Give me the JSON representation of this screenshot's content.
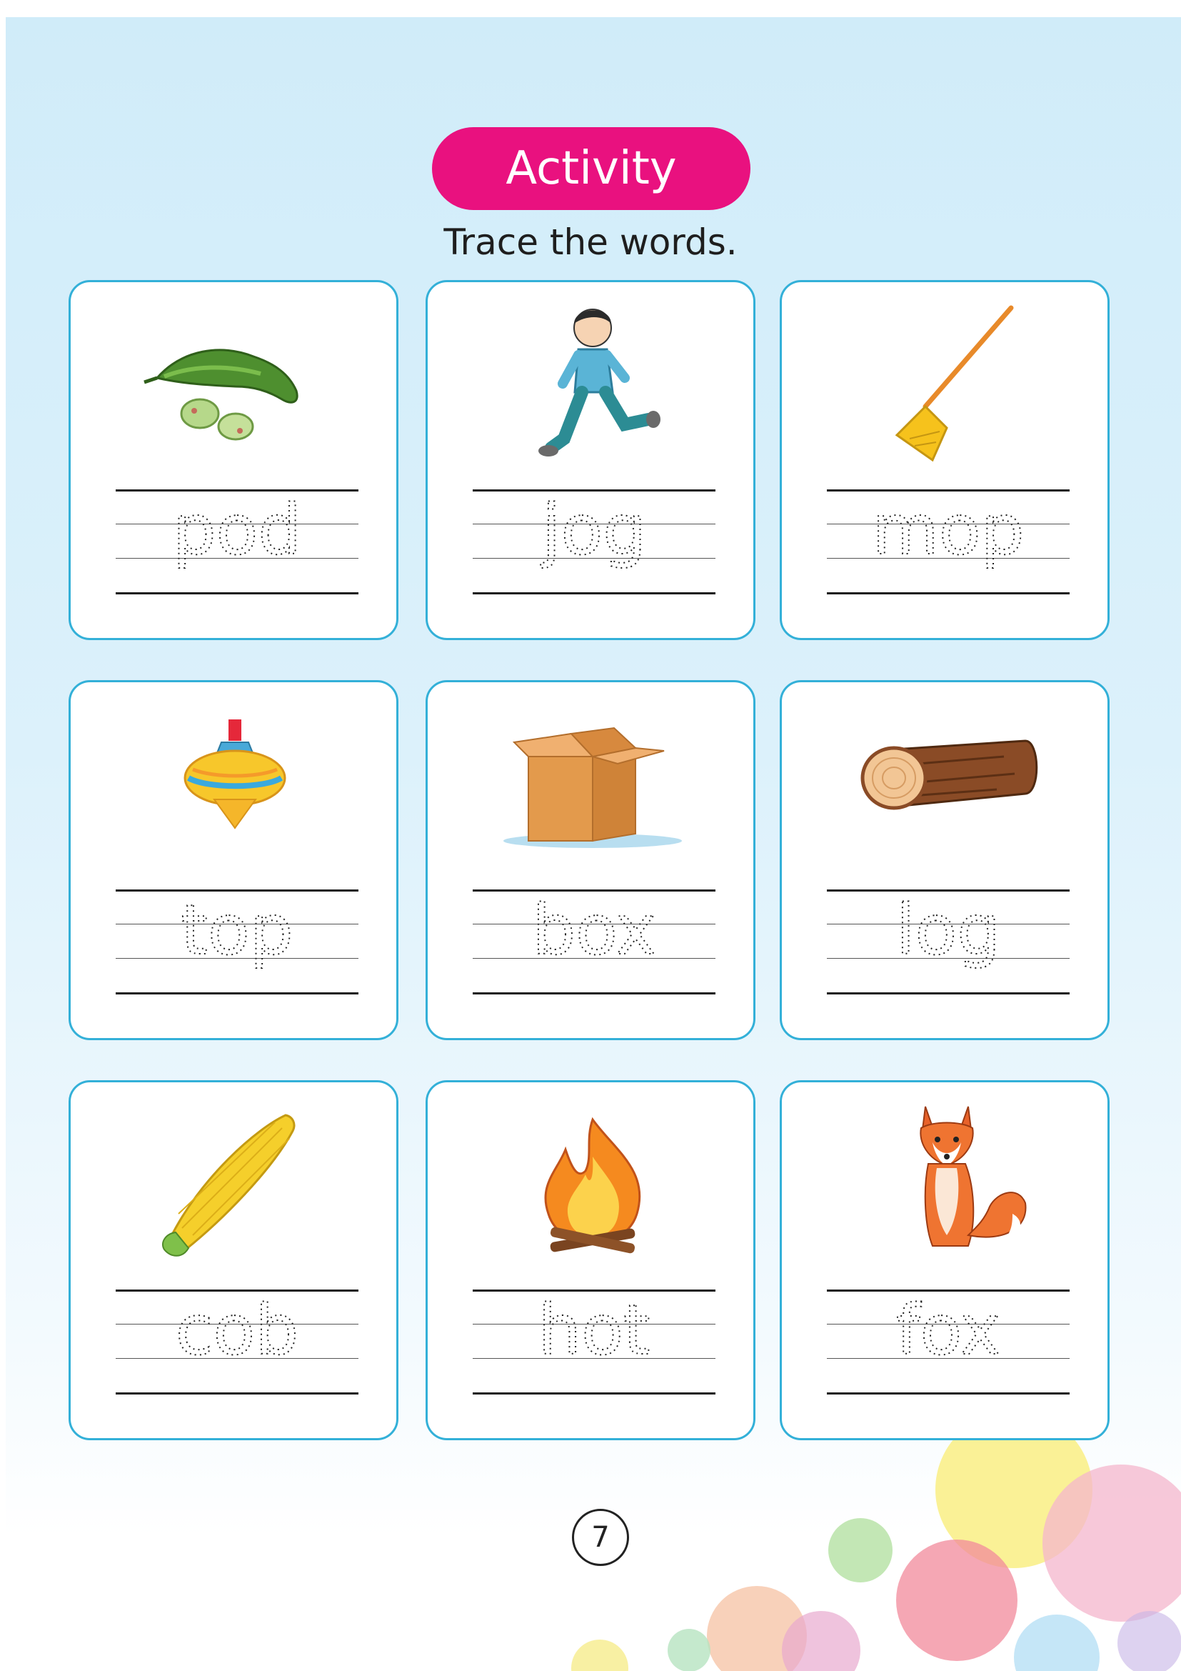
{
  "header": {
    "badge": "Activity",
    "instruction": "Trace the words."
  },
  "cards": [
    {
      "word": "pod",
      "icon": "pea-pod-icon"
    },
    {
      "word": "jog",
      "icon": "jogging-boy-icon"
    },
    {
      "word": "mop",
      "icon": "mop-icon"
    },
    {
      "word": "top",
      "icon": "spinning-top-icon"
    },
    {
      "word": "box",
      "icon": "cardboard-box-icon"
    },
    {
      "word": "log",
      "icon": "wooden-log-icon"
    },
    {
      "word": "cob",
      "icon": "corn-cob-icon"
    },
    {
      "word": "hot",
      "icon": "campfire-icon"
    },
    {
      "word": "fox",
      "icon": "fox-icon"
    }
  ],
  "footer": {
    "page_number": "7"
  },
  "colors": {
    "badge": "#e9117f",
    "card_border": "#33b0d8",
    "background": "#d0ecf9"
  }
}
